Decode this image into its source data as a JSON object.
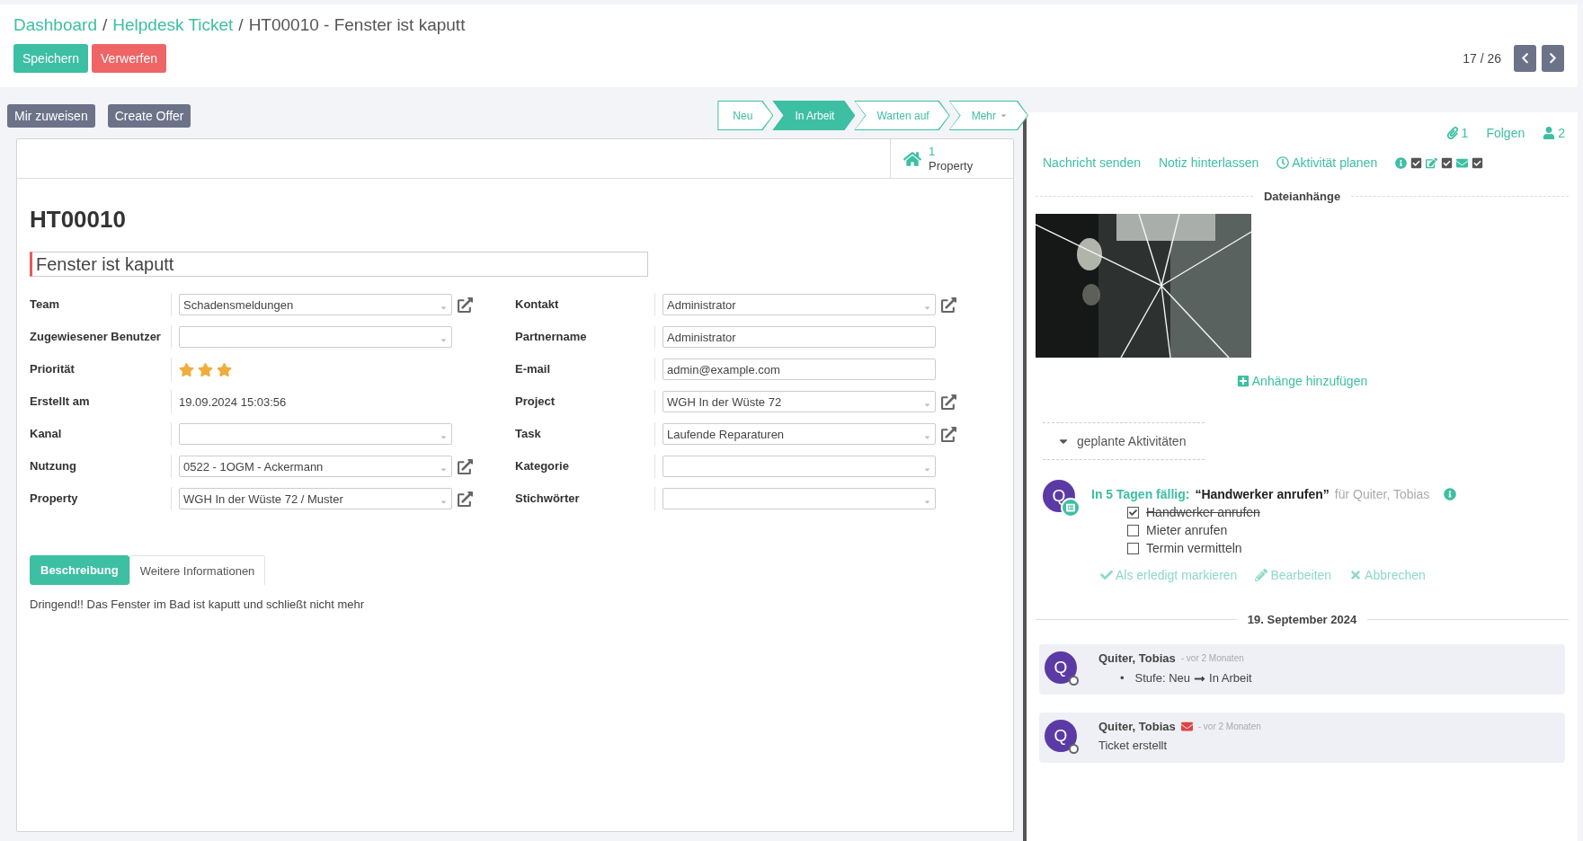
{
  "breadcrumb": [
    {
      "label": "Dashboard",
      "kind": "link"
    },
    {
      "label": "Helpdesk Ticket",
      "kind": "link",
      "separator": "/"
    },
    {
      "label": "HT00010 - Fenster ist kaputt",
      "kind": "current",
      "separator": "/"
    }
  ],
  "header_buttons": [
    {
      "label": "Speichern",
      "kind": "primary"
    },
    {
      "label": "Verwerfen",
      "kind": "danger"
    }
  ],
  "pager": {
    "text": "17 / 26"
  },
  "action_buttons": [
    "Mir zuweisen",
    "Create Offer"
  ],
  "stages": [
    {
      "label": "Neu",
      "selected": false
    },
    {
      "label": "In Arbeit",
      "selected": true
    },
    {
      "label": "Warten auf",
      "selected": false
    }
  ],
  "stages_more": "Mehr",
  "smart_button": {
    "count": "1",
    "label": "Property"
  },
  "ticket_number": "HT00010",
  "title_field": {
    "value": "Fenster ist kaputt"
  },
  "left_fields": [
    {
      "label": "Team",
      "kind": "select",
      "value": "Schadensmeldungen",
      "external_link": true
    },
    {
      "label": "Zugewiesener Benutzer",
      "kind": "select",
      "external_link": false
    },
    {
      "label": "Priorität",
      "kind": "stars",
      "stars": 3
    },
    {
      "label": "Erstellt am",
      "kind": "text",
      "value": "19.09.2024 15:03:56"
    },
    {
      "label": "Kanal",
      "kind": "select",
      "external_link": false
    },
    {
      "label": "Nutzung",
      "kind": "select",
      "value": "0522 - 1OGM - Ackermann",
      "external_link": true
    },
    {
      "label": "Property",
      "kind": "select",
      "value": "WGH In der Wüste 72 / Muster",
      "external_link": true
    }
  ],
  "right_fields": [
    {
      "label": "Kontakt",
      "kind": "select",
      "value": "Administrator",
      "external_link": true
    },
    {
      "label": "Partnername",
      "kind": "input",
      "value": "Administrator"
    },
    {
      "label": "E-mail",
      "kind": "input",
      "value": "admin@example.com"
    },
    {
      "label": "Project",
      "kind": "select",
      "value": "WGH In der Wüste 72",
      "external_link": true
    },
    {
      "label": "Task",
      "kind": "select",
      "value": "Laufende Reparaturen",
      "external_link": true
    },
    {
      "label": "Kategorie",
      "kind": "select",
      "external_link": false
    },
    {
      "label": "Stichwörter",
      "kind": "tags"
    }
  ],
  "tabs": [
    {
      "label": "Beschreibung",
      "selected": true
    },
    {
      "label": "Weitere Informationen",
      "selected": false
    }
  ],
  "description": "Dringend!! Das Fenster im Bad ist kaputt und schließt nicht mehr",
  "chatter": {
    "attachments_count": "1",
    "follow": "Folgen",
    "followers_count": "2",
    "actions": [
      {
        "label": "Nachricht senden",
        "kind": "plain"
      },
      {
        "label": "Notiz hinterlassen",
        "kind": "plain"
      },
      {
        "label": "Aktivität planen",
        "kind": "clock"
      }
    ],
    "attachments_title": "Dateianhänge",
    "add_attachment": "Anhänge hinzufügen",
    "activities_toggle": {
      "label": "geplante Aktivitäten",
      "expanded": true
    },
    "activity": {
      "avatar": "Q",
      "due": "In 5 Tagen fällig:",
      "summary": "“Handwerker anrufen”",
      "assignee": "für Quiter, Tobias",
      "checklist": [
        {
          "label": "Handwerker anrufen",
          "checked": true
        },
        {
          "label": "Mieter anrufen",
          "checked": false
        },
        {
          "label": "Termin vermitteln",
          "checked": false
        }
      ],
      "actions": [
        {
          "label": "Als erledigt markieren",
          "kind": "done"
        },
        {
          "label": "Bearbeiten",
          "kind": "edit"
        },
        {
          "label": "Abbrechen",
          "kind": "cancel"
        }
      ]
    },
    "date_separator": "19. September 2024",
    "messages": [
      {
        "avatar": "Q",
        "author": "Quiter, Tobias",
        "time": "- vor 2 Monaten",
        "via_email": false,
        "kind": "tracking",
        "marker": "•",
        "field": "Stufe:",
        "old": "Neu",
        "new": "In Arbeit"
      },
      {
        "avatar": "Q",
        "author": "Quiter, Tobias",
        "time": "- vor 2 Monaten",
        "via_email": true,
        "kind": "text",
        "body": "Ticket erstellt"
      }
    ]
  }
}
